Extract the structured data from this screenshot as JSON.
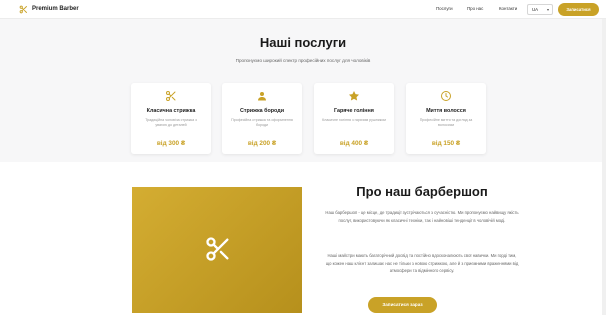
{
  "brand": {
    "name": "Premium Barber"
  },
  "nav": {
    "items": [
      "Послуги",
      "Про нас",
      "Контакти"
    ]
  },
  "lang": {
    "current": "UA"
  },
  "header": {
    "cta_label": "Записатися"
  },
  "services": {
    "title": "Наші послуги",
    "subtitle": "Пропонуємо широкий спектр професійних послуг для чоловіків",
    "cards": [
      {
        "icon": "scissors-icon",
        "title": "Класична стрижка",
        "desc": "Традиційна чоловіча стрижка з увагою до деталей",
        "price": "від 300 ₴"
      },
      {
        "icon": "user-icon",
        "title": "Стрижка бороди",
        "desc": "Професійна стрижка та оформлення бороди",
        "price": "від 200 ₴"
      },
      {
        "icon": "star-icon",
        "title": "Гаряче гоління",
        "desc": "Класичне гоління з гарячим рушником",
        "price": "від 400 ₴"
      },
      {
        "icon": "clock-icon",
        "title": "Миття волосся",
        "desc": "Професійне миття та догляд за волоссям",
        "price": "від 150 ₴"
      }
    ]
  },
  "about": {
    "title": "Про наш барбершоп",
    "p1": "Наш барбершоп - це місце, де традиції зустрічаються з сучасністю. Ми пропонуємо найвищу якість послуг, використовуючи як класичні техніки, так і найновіші тенденції в чоловічій моді.",
    "p2": "Наші майстри мають багаторічний досвід та постійно вдосконалюють свої навички. Ми гордi тим, що кожен наш клієнт залишає нас не тільки з новою стрижкою, але й з приємними враженнями від атмосфери та відмінного сервісу.",
    "cta_label": "Записатися зараз"
  },
  "colors": {
    "accent": "#c9a227",
    "background": "#f7f7f8"
  }
}
